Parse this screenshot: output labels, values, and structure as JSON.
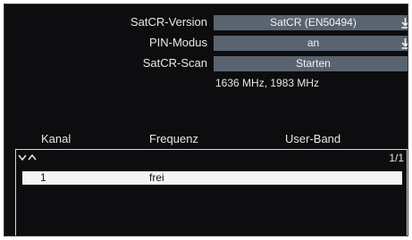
{
  "settings": {
    "satcr_version": {
      "label": "SatCR-Version",
      "value": "SatCR (EN50494)"
    },
    "pin_modus": {
      "label": "PIN-Modus",
      "value": "an"
    },
    "satcr_scan": {
      "label": "SatCR-Scan",
      "value": "Starten"
    },
    "frequencies_info": "1636 MHz, 1983 MHz"
  },
  "table": {
    "columns": [
      "Kanal",
      "Frequenz",
      "User-Band"
    ],
    "page_indicator": "1/1",
    "rows": [
      {
        "kanal": "1",
        "frequenz": "frei",
        "user_band": ""
      }
    ]
  },
  "colors": {
    "background": "#0d0d0f",
    "field": "#5a6470",
    "row_highlight": "#f4f4f4"
  }
}
